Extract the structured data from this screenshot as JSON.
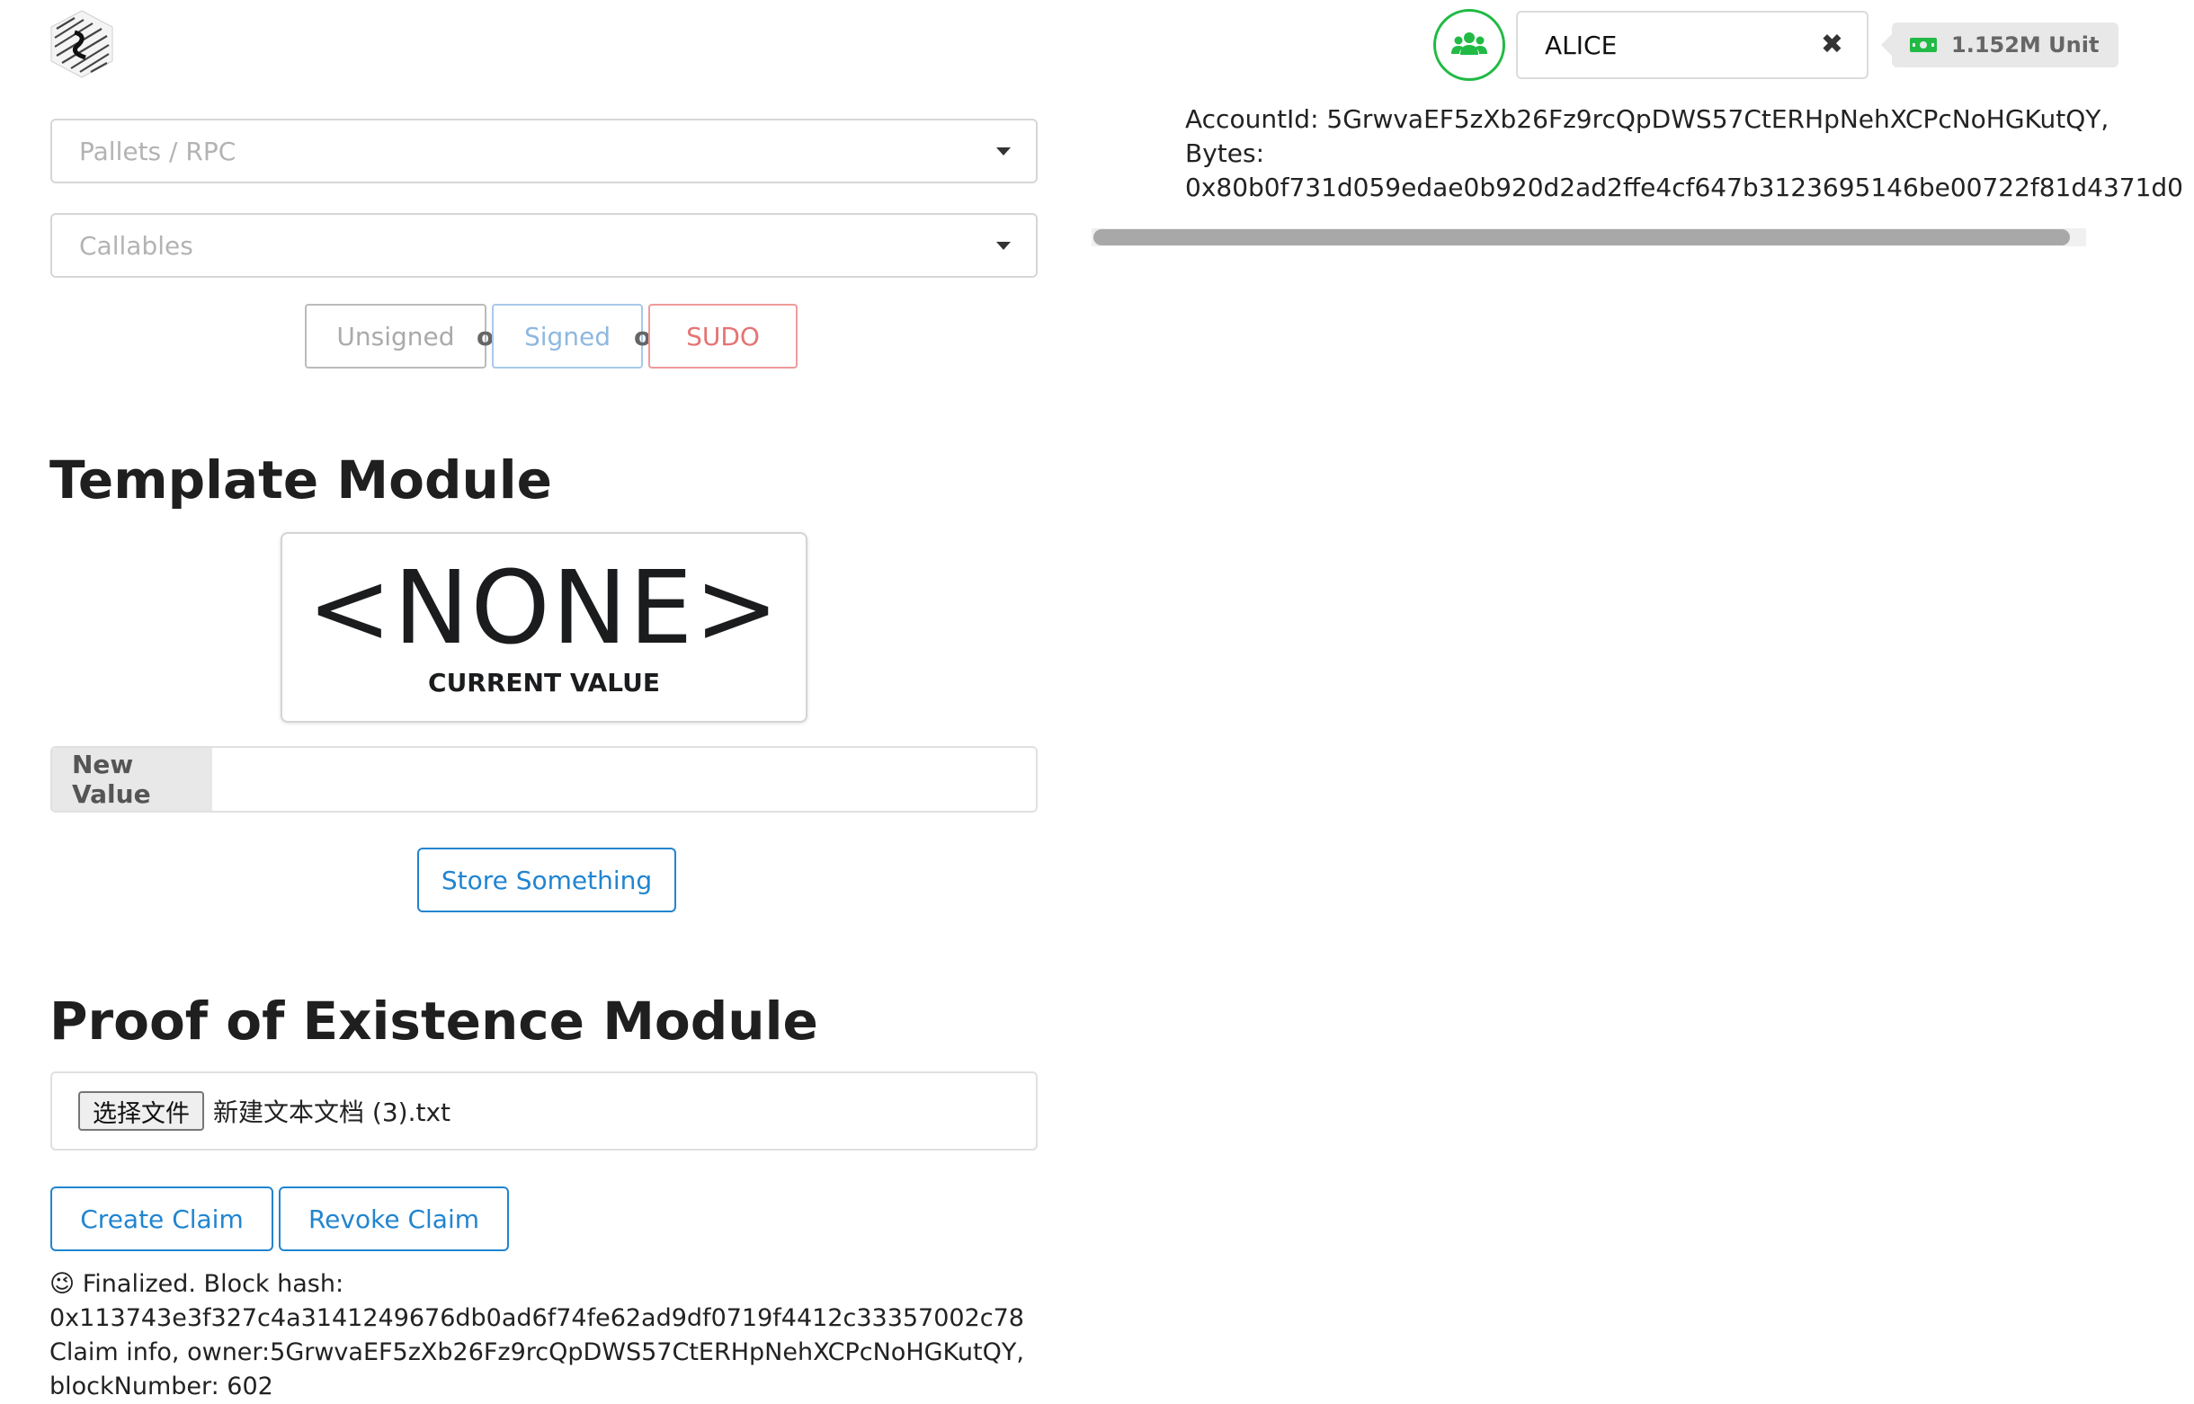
{
  "header": {
    "account_name": "ALICE",
    "balance": "1.152M Unit",
    "account_id_line": "AccountId: 5GrwvaEF5zXb26Fz9rcQpDWS57CtERHpNehXCPcNoHGKutQY,",
    "bytes_label": "Bytes:",
    "bytes_value": "0x80b0f731d059edae0b920d2ad2ffe4cf647b3123695146be00722f81d4371d0",
    "icons": [
      "logo",
      "users-icon",
      "close-icon",
      "money-icon"
    ],
    "accent_color": "#21ba45"
  },
  "extrinsics": {
    "pallets_placeholder": "Pallets / RPC",
    "callables_placeholder": "Callables",
    "unsigned_label": "Unsigned",
    "or_label": "or",
    "signed_label": "Signed",
    "sudo_label": "SUDO"
  },
  "template_module": {
    "title": "Template Module",
    "current_value": "<NONE>",
    "current_value_label": "CURRENT VALUE",
    "new_value_label": "New Value",
    "new_value": "",
    "store_button": "Store Something"
  },
  "poe_module": {
    "title": "Proof of Existence Module",
    "choose_file_button": "选择文件",
    "file_name": "新建文本文档 (3).txt",
    "create_claim_button": "Create Claim",
    "revoke_claim_button": "Revoke Claim",
    "status_line1": "😉 Finalized. Block hash:",
    "status_line2": "0x113743e3f327c4a3141249676db0ad6f74fe62ad9df0719f4412c33357002c78",
    "status_line3": "Claim info, owner:5GrwvaEF5zXb26Fz9rcQpDWS57CtERHpNehXCPcNoHGKutQY,",
    "status_line4": "blockNumber: 602"
  }
}
